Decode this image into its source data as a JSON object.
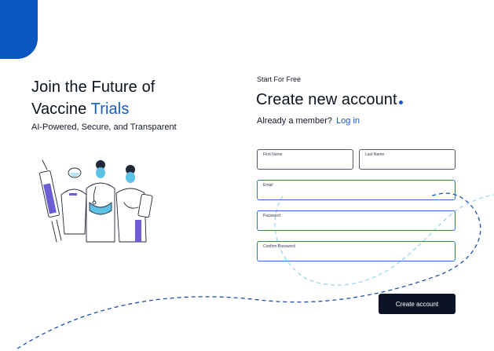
{
  "brand": {
    "accent_color": "#0a57c1",
    "link_color": "#1459c8",
    "button_color": "#0b1324"
  },
  "hero": {
    "headline_line1": "Join the Future of",
    "headline_line2_prefix": "Vaccine",
    "headline_line2_accent": "Trials",
    "tagline": "AI-Powered, Secure, and Transparent",
    "illustration_icon": "doctors-with-vaccine-syringe-illustration"
  },
  "form": {
    "kicker": "Start For Free",
    "title": "Create new account",
    "member_prompt": "Already a member?",
    "login_link": "Log in",
    "fields": {
      "first_name": {
        "label": "First Name",
        "value": ""
      },
      "last_name": {
        "label": "Last Name",
        "value": ""
      },
      "email": {
        "label": "Email",
        "value": ""
      },
      "password": {
        "label": "Password",
        "value": ""
      },
      "confirm_password": {
        "label": "Confirm Password",
        "value": ""
      }
    },
    "submit_label": "Create account"
  }
}
